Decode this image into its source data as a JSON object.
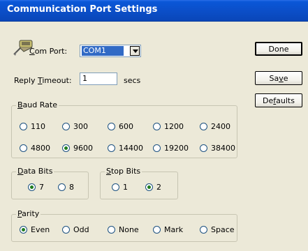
{
  "window": {
    "title": "Communication Port Settings"
  },
  "com_port": {
    "label": "Com Port:",
    "value": "COM1"
  },
  "reply_timeout": {
    "label": "Reply Timeout:",
    "value": "1",
    "unit": "secs"
  },
  "buttons": {
    "done": "Done",
    "save": "Save",
    "defaults": "Defaults"
  },
  "baud_rate": {
    "label": "Baud Rate",
    "options": [
      "110",
      "300",
      "600",
      "1200",
      "2400",
      "4800",
      "9600",
      "14400",
      "19200",
      "38400"
    ],
    "selected": "9600"
  },
  "data_bits": {
    "label": "Data Bits",
    "options": [
      "7",
      "8"
    ],
    "selected": "7"
  },
  "stop_bits": {
    "label": "Stop Bits",
    "options": [
      "1",
      "2"
    ],
    "selected": "2"
  },
  "parity": {
    "label": "Parity",
    "options": [
      "Even",
      "Odd",
      "None",
      "Mark",
      "Space"
    ],
    "selected": "Even"
  },
  "icons": {
    "port": "serial-port-icon"
  }
}
